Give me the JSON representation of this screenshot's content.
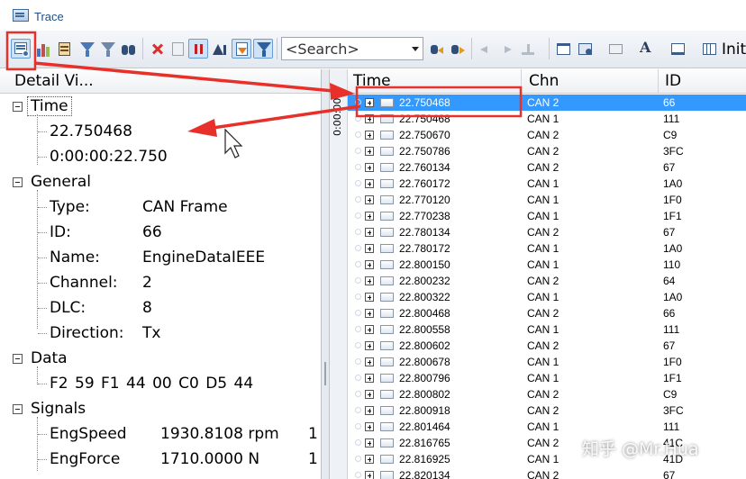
{
  "window": {
    "title": "Trace"
  },
  "toolbar": {
    "search_placeholder": "<Search>",
    "init_label": "Init"
  },
  "detail": {
    "header": "Detail Vi...",
    "groups": [
      {
        "label": "Time",
        "items": [
          {
            "value": "22.750468"
          },
          {
            "value": "0:00:00:22.750"
          }
        ]
      },
      {
        "label": "General",
        "items": [
          {
            "key": "Type:",
            "value": "CAN Frame"
          },
          {
            "key": "ID:",
            "value": "66"
          },
          {
            "key": "Name:",
            "value": "EngineDataIEEE"
          },
          {
            "key": "Channel:",
            "value": "2"
          },
          {
            "key": "DLC:",
            "value": "8"
          },
          {
            "key": "Direction:",
            "value": "Tx"
          }
        ]
      },
      {
        "label": "Data",
        "items": [
          {
            "value": "F2  59  F1  44  00  C0  D5  44"
          }
        ]
      },
      {
        "label": "Signals",
        "items": [
          {
            "key": "EngSpeed",
            "value": "1930.8108 rpm",
            "extra": "1"
          },
          {
            "key": "EngForce",
            "value": "1710.0000 N",
            "extra": "1"
          }
        ]
      }
    ]
  },
  "grid": {
    "timeline_label": "0:00:00:0",
    "columns": [
      "Time",
      "Chn",
      "ID"
    ],
    "selected_index": 0,
    "rows": [
      [
        "22.750468",
        "CAN 2",
        "66"
      ],
      [
        "22.750468",
        "CAN 1",
        "111"
      ],
      [
        "22.750670",
        "CAN 2",
        "C9"
      ],
      [
        "22.750786",
        "CAN 2",
        "3FC"
      ],
      [
        "22.760134",
        "CAN 2",
        "67"
      ],
      [
        "22.760172",
        "CAN 1",
        "1A0"
      ],
      [
        "22.770120",
        "CAN 1",
        "1F0"
      ],
      [
        "22.770238",
        "CAN 1",
        "1F1"
      ],
      [
        "22.780134",
        "CAN 2",
        "67"
      ],
      [
        "22.780172",
        "CAN 1",
        "1A0"
      ],
      [
        "22.800150",
        "CAN 1",
        "110"
      ],
      [
        "22.800232",
        "CAN 2",
        "64"
      ],
      [
        "22.800322",
        "CAN 1",
        "1A0"
      ],
      [
        "22.800468",
        "CAN 2",
        "66"
      ],
      [
        "22.800558",
        "CAN 1",
        "111"
      ],
      [
        "22.800602",
        "CAN 2",
        "67"
      ],
      [
        "22.800678",
        "CAN 1",
        "1F0"
      ],
      [
        "22.800796",
        "CAN 1",
        "1F1"
      ],
      [
        "22.800802",
        "CAN 2",
        "C9"
      ],
      [
        "22.800918",
        "CAN 2",
        "3FC"
      ],
      [
        "22.801464",
        "CAN 1",
        "111"
      ],
      [
        "22.816765",
        "CAN 2",
        "41C"
      ],
      [
        "22.816925",
        "CAN 1",
        "41D"
      ],
      [
        "22.820134",
        "CAN 2",
        "67"
      ]
    ]
  },
  "watermark": "知乎 @Mr.Hua",
  "colors": {
    "selection": "#3399ff",
    "annotation": "#e8302a",
    "title": "#1e4f8a"
  }
}
